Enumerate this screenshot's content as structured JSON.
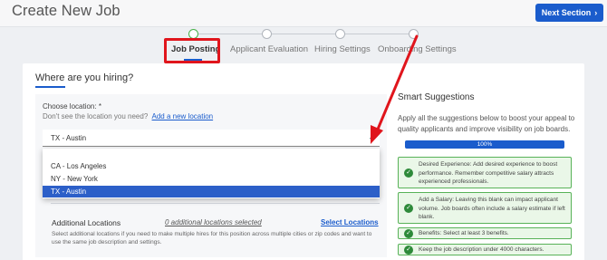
{
  "header": {
    "title": "Create New Job",
    "next_button": "Next Section",
    "next_icon": "chevron-right-icon"
  },
  "stepper": {
    "tabs": [
      {
        "label": "Job Posting",
        "active": true
      },
      {
        "label": "Applicant Evaluation",
        "active": false
      },
      {
        "label": "Hiring Settings",
        "active": false
      },
      {
        "label": "Onboarding Settings",
        "active": false
      }
    ]
  },
  "location": {
    "section_title": "Where are you hiring?",
    "label": "Choose location: *",
    "help_text": "Don't see the location you need?",
    "help_link": "Add a new location",
    "selected": "TX - Austin",
    "options": [
      "CA - Los Angeles",
      "NY - New York",
      "TX - Austin"
    ],
    "caret_icon": "chevron-down-icon"
  },
  "additional_locations": {
    "title": "Additional Locations",
    "count": "0 additional locations selected",
    "link": "Select Locations",
    "description": "Select additional locations if you need to make multiple hires for this position across multiple cities or zip codes and want to use the same job description and settings."
  },
  "smart_suggestions": {
    "title": "Smart Suggestions",
    "description": "Apply all the suggestions below to boost your appeal to quality applicants and improve visibility on job boards.",
    "progress_label": "100%",
    "progress": 1.0,
    "items": [
      "Desired Experience: Add desired experience to boost performance. Remember competitive salary attracts experienced professionals.",
      "Add a Salary: Leaving this blank can impact applicant volume. Job boards often include a salary estimate if left blank.",
      "Benefits: Select at least 3 benefits.",
      "Keep the job description under 4000 characters."
    ]
  },
  "colors": {
    "accent": "#1a5ccc",
    "annotation_red": "#e0151c",
    "success_green": "#2e8a3a"
  }
}
